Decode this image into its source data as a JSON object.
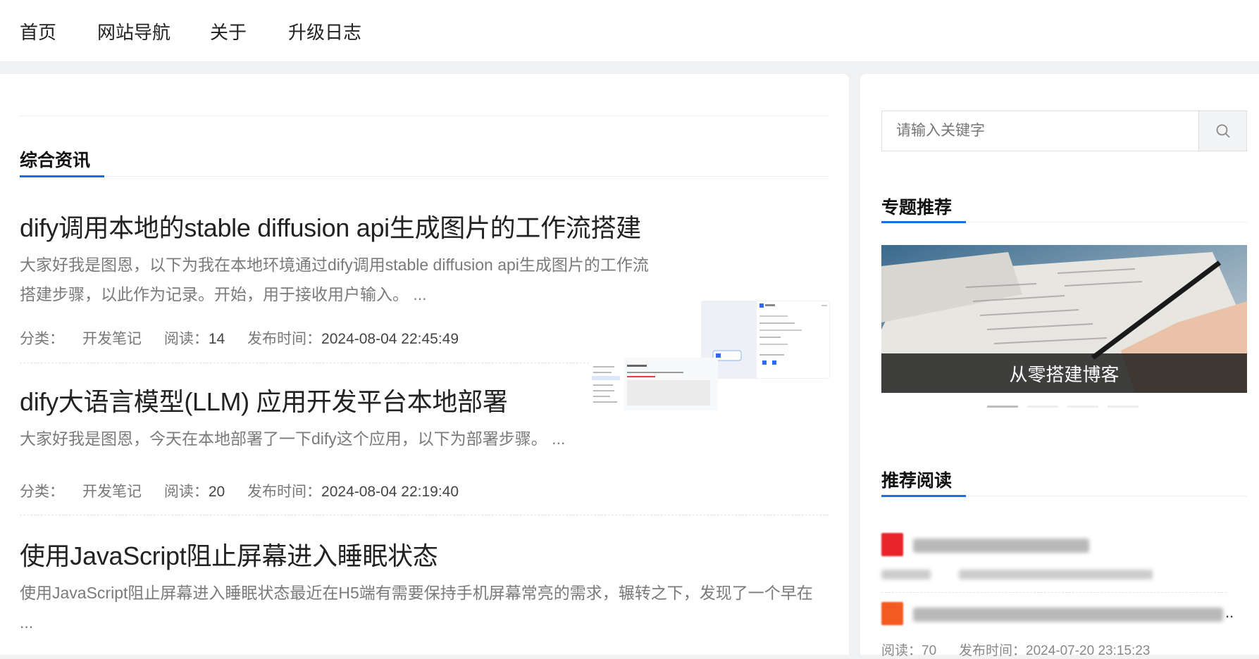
{
  "nav": {
    "items": [
      "首页",
      "网站导航",
      "关于",
      "升级日志"
    ]
  },
  "main": {
    "section_title": "综合资讯",
    "articles": [
      {
        "title": "dify调用本地的stable diffusion api生成图片的工作流搭建",
        "desc_line1": "大家好我是图恩，以下为我在本地环境通过dify调用stable diffusion api生成图片的工作流",
        "desc_line2": "搭建步骤，以此作为记录。开始，用于接收用户输入。 ...",
        "category_label": "分类：",
        "category": "开发笔记",
        "read_label": "阅读：",
        "read": "14",
        "time_label": "发布时间：",
        "time": "2024-08-04 22:45:49"
      },
      {
        "title": "dify大语言模型(LLM) 应用开发平台本地部署",
        "desc_line1": "大家好我是图恩，今天在本地部署了一下dify这个应用，以下为部署步骤。 ...",
        "desc_line2": "",
        "category_label": "分类：",
        "category": "开发笔记",
        "read_label": "阅读：",
        "read": "20",
        "time_label": "发布时间：",
        "time": "2024-08-04 22:19:40"
      },
      {
        "title": "使用JavaScript阻止屏幕进入睡眠状态",
        "desc_line1": "使用JavaScript阻止屏幕进入睡眠状态最近在H5端有需要保持手机屏幕常亮的需求，辗转之下，发现了一个早在",
        "desc_line2": "..."
      }
    ]
  },
  "sidebar": {
    "search_placeholder": "请输入关键字",
    "topic_title": "专题推荐",
    "banner_caption": "从零搭建博客",
    "reading_title": "推荐阅读",
    "rec_meta_read": "阅读：70",
    "rec_meta_time": "发布时间：2024-07-20 23:15:23",
    "ellipsis": ".."
  },
  "colors": {
    "accent": "#1a6fe0",
    "rec_icon_1": "#e8232a",
    "rec_icon_2": "#f25a1f"
  }
}
